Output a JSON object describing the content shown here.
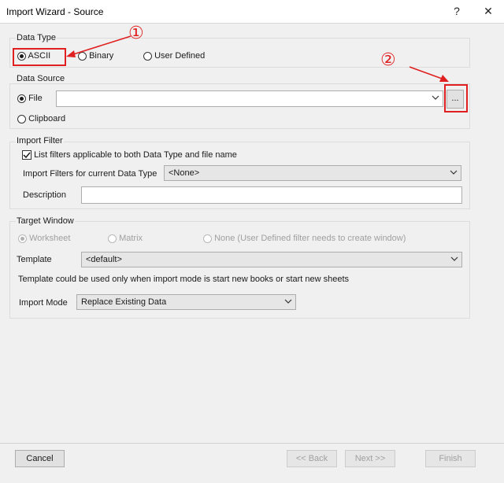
{
  "window": {
    "title": "Import Wizard - Source",
    "help_label": "?",
    "close_label": "✕"
  },
  "data_type": {
    "legend": "Data Type",
    "options": [
      {
        "label": "ASCII",
        "checked": true
      },
      {
        "label": "Binary",
        "checked": false
      },
      {
        "label": "User Defined",
        "checked": false
      }
    ]
  },
  "data_source": {
    "legend": "Data Source",
    "file_label": "File",
    "file_value": "",
    "browse_label": "...",
    "clipboard_label": "Clipboard"
  },
  "import_filter": {
    "legend": "Import Filter",
    "list_filters_label": "List filters applicable to both Data Type and file name",
    "list_filters_checked": true,
    "filters_label": "Import Filters for current Data Type",
    "filters_value": "<None>",
    "description_label": "Description",
    "description_value": ""
  },
  "target_window": {
    "legend": "Target Window",
    "options": [
      {
        "label": "Worksheet",
        "checked": true,
        "disabled": true
      },
      {
        "label": "Matrix",
        "checked": false,
        "disabled": true
      },
      {
        "label": "None (User Defined filter needs to create window)",
        "checked": false,
        "disabled": true
      }
    ],
    "template_label": "Template",
    "template_value": "<default>",
    "note": "Template could be used only when import mode is start new books or start new sheets",
    "import_mode_label": "Import Mode",
    "import_mode_value": "Replace Existing Data"
  },
  "annotations": {
    "marker_1": "①",
    "marker_2": "②",
    "color": "#e02020"
  },
  "footer": {
    "cancel_label": "Cancel",
    "back_label": "<< Back",
    "next_label": "Next >>",
    "finish_label": "Finish"
  }
}
